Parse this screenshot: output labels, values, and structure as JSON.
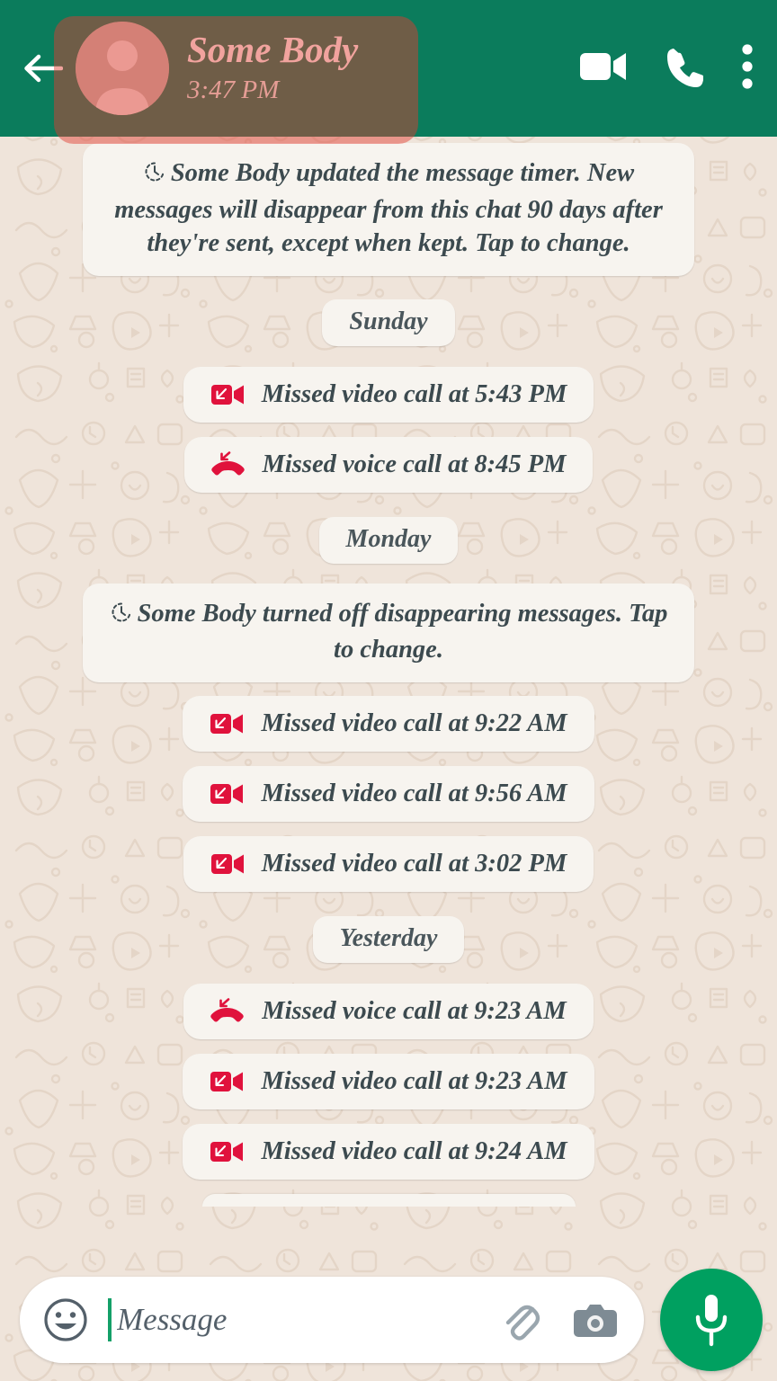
{
  "app": "WhatsApp",
  "colors": {
    "header_green": "#0B7C5C",
    "chat_background": "#EFE4DA",
    "bubble": "#F7F4EF",
    "missed_call_red": "#E0123C",
    "mic_green": "#00A060",
    "cursor_green": "#14A068",
    "highlight_overlay": "rgba(226, 60, 48, 0.47)",
    "text_dark": "#3C4A4F"
  },
  "header": {
    "back_icon": "back-arrow-icon",
    "avatar_icon": "default-person-avatar-icon",
    "contact_name": "Some Body",
    "status": "3:47 PM",
    "actions": [
      {
        "name": "video-call-button",
        "icon": "video-camera-icon"
      },
      {
        "name": "voice-call-button",
        "icon": "phone-icon"
      },
      {
        "name": "overflow-menu-button",
        "icon": "three-dots-vertical-icon"
      }
    ],
    "highlight_overlay_present": true
  },
  "conversation": [
    {
      "kind": "system",
      "icon": "disappearing-messages-timer-icon",
      "text": "Some Body updated the message timer. New messages will disappear from this chat 90 days after they're sent, except when kept. Tap to change."
    },
    {
      "kind": "day",
      "label": "Sunday"
    },
    {
      "kind": "call",
      "icon": "missed-video-call-icon",
      "text": "Missed video call at 5:43 PM"
    },
    {
      "kind": "call",
      "icon": "missed-voice-call-icon",
      "text": "Missed voice call at 8:45 PM"
    },
    {
      "kind": "day",
      "label": "Monday"
    },
    {
      "kind": "system",
      "icon": "disappearing-messages-timer-icon",
      "text": "Some Body turned off disappearing messages. Tap to change."
    },
    {
      "kind": "call",
      "icon": "missed-video-call-icon",
      "text": "Missed video call at 9:22 AM"
    },
    {
      "kind": "call",
      "icon": "missed-video-call-icon",
      "text": "Missed video call at 9:56 AM"
    },
    {
      "kind": "call",
      "icon": "missed-video-call-icon",
      "text": "Missed video call at 3:02 PM"
    },
    {
      "kind": "day",
      "label": "Yesterday"
    },
    {
      "kind": "call",
      "icon": "missed-voice-call-icon",
      "text": "Missed voice call at 9:23 AM"
    },
    {
      "kind": "call",
      "icon": "missed-video-call-icon",
      "text": "Missed video call at 9:23 AM"
    },
    {
      "kind": "call",
      "icon": "missed-video-call-icon",
      "text": "Missed video call at 9:24 AM"
    },
    {
      "kind": "clipped"
    }
  ],
  "composer": {
    "emoji_icon": "smiley-face-icon",
    "placeholder": "Message",
    "value": "",
    "attach_icon": "paperclip-icon",
    "camera_icon": "camera-icon",
    "mic_icon": "microphone-icon"
  }
}
